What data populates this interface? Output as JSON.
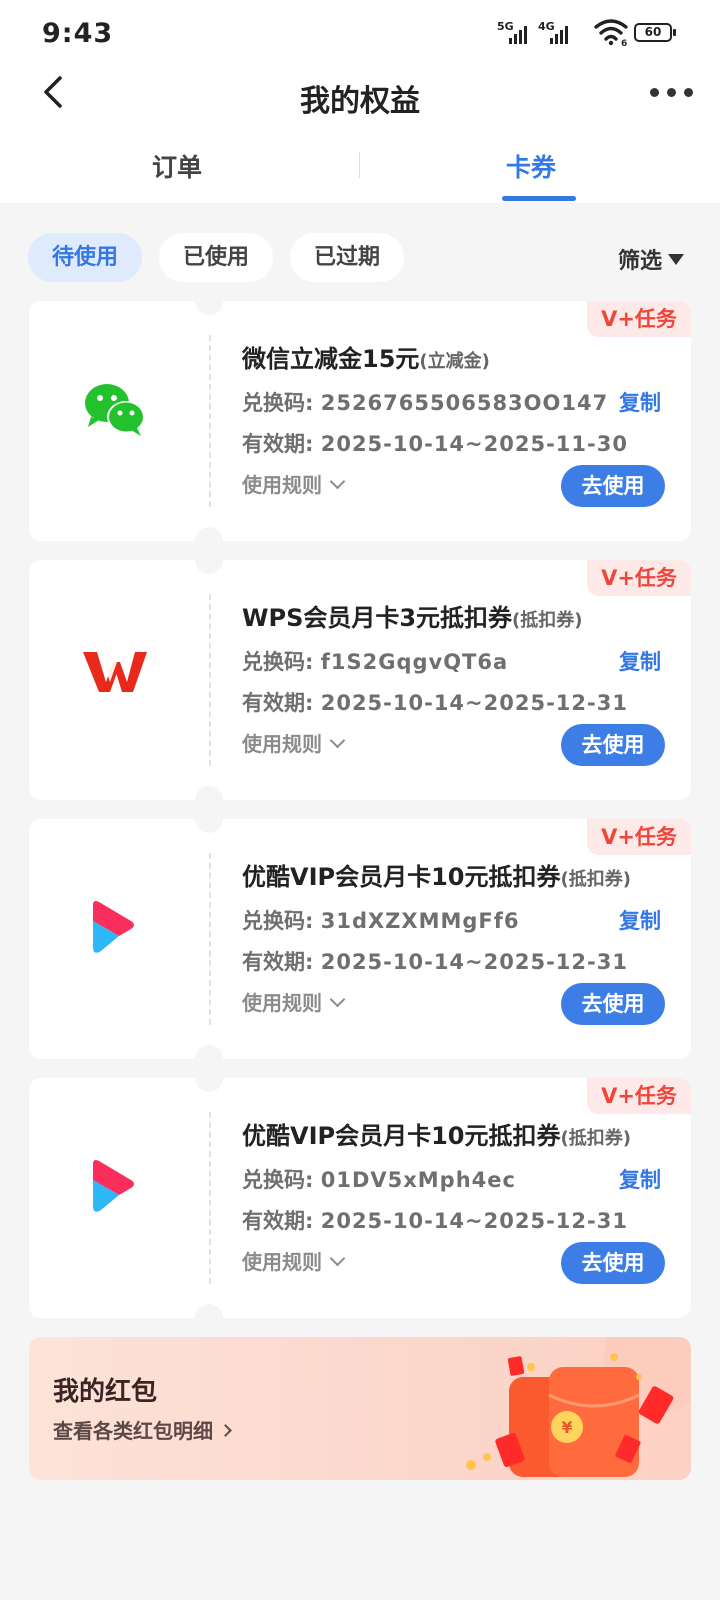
{
  "status_bar": {
    "time": "9:43",
    "signal1": "5G",
    "signal2": "4G",
    "wifi_sub": "6",
    "battery": "60"
  },
  "header": {
    "title": "我的权益"
  },
  "tabs": [
    {
      "label": "订单",
      "active": false
    },
    {
      "label": "卡券",
      "active": true
    }
  ],
  "filters": {
    "chips": [
      {
        "label": "待使用",
        "active": true
      },
      {
        "label": "已使用",
        "active": false
      },
      {
        "label": "已过期",
        "active": false
      }
    ],
    "filter_label": "筛选"
  },
  "coupons": [
    {
      "tag": "V+任务",
      "icon": "wechat-icon",
      "title": "微信立减金15元",
      "type": "(立减金)",
      "code_label": "兑换码:",
      "code": "2526765506583OO147",
      "copy": "复制",
      "valid_label": "有效期:",
      "valid": "2025-10-14~2025-11-30",
      "rules": "使用规则",
      "use": "去使用"
    },
    {
      "tag": "V+任务",
      "icon": "wps-icon",
      "title": "WPS会员月卡3元抵扣券",
      "type": "(抵扣券)",
      "code_label": "兑换码:",
      "code": "f1S2GqgvQT6a",
      "copy": "复制",
      "valid_label": "有效期:",
      "valid": "2025-10-14~2025-12-31",
      "rules": "使用规则",
      "use": "去使用"
    },
    {
      "tag": "V+任务",
      "icon": "youku-icon",
      "title": "优酷VIP会员月卡10元抵扣券",
      "type": "(抵扣券)",
      "code_label": "兑换码:",
      "code": "31dXZXMMgFf6",
      "copy": "复制",
      "valid_label": "有效期:",
      "valid": "2025-10-14~2025-12-31",
      "rules": "使用规则",
      "use": "去使用"
    },
    {
      "tag": "V+任务",
      "icon": "youku-icon",
      "title": "优酷VIP会员月卡10元抵扣券",
      "type": "(抵扣券)",
      "code_label": "兑换码:",
      "code": "01DV5xMph4ec",
      "copy": "复制",
      "valid_label": "有效期:",
      "valid": "2025-10-14~2025-12-31",
      "rules": "使用规则",
      "use": "去使用"
    }
  ],
  "red_packet": {
    "title": "我的红包",
    "subtitle": "查看各类红包明细"
  },
  "colors": {
    "accent": "#3478e5",
    "button": "#3d7ee6",
    "tag_text": "#f0453a",
    "tag_bg": "#fde9e7",
    "page_bg": "#f5f5f6"
  }
}
